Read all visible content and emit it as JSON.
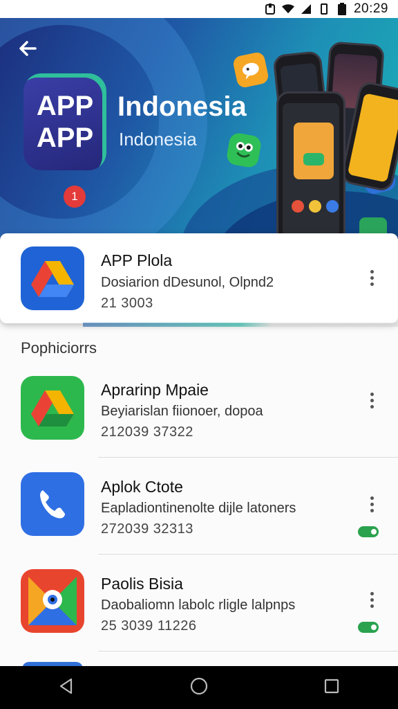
{
  "status_bar": {
    "time": "20:29",
    "icons": [
      "nfc-icon",
      "wifi-icon",
      "signal-icon",
      "vibrate-icon",
      "battery-icon"
    ]
  },
  "hero": {
    "back_icon": "arrow-back-icon",
    "logo_line1": "APP",
    "logo_line2": "APP",
    "title": "Indonesia",
    "subtitle": "Indonesia",
    "badge_count": "1"
  },
  "featured": {
    "icon": "drive-triangle-icon",
    "title": "APP Plola",
    "description": "Dosiarion dDesunol, Olpnd2",
    "meta": "21 3003",
    "more_icon": "more-vert-icon"
  },
  "section": {
    "header": "Pophiciorrs"
  },
  "apps": [
    {
      "icon": "drive-triangle-icon",
      "title": "Aprarinp Mpaie",
      "description": "Beyiarislan fiionoer, dopoa",
      "meta": "212039 37322",
      "more_icon": "more-vert-icon",
      "toggle": false
    },
    {
      "icon": "phone-icon",
      "title": "Aplok Ctote",
      "description": "Eapladiontinenolte dijle latoners",
      "meta": "272039 32313",
      "more_icon": "more-vert-icon",
      "toggle": true
    },
    {
      "icon": "maps-pin-icon",
      "title": "Paolis Bisia",
      "description": "Daobaliomn labolc rligle lalpnps",
      "meta": "25 3039 11226",
      "more_icon": "more-vert-icon",
      "toggle": true
    }
  ],
  "nav": {
    "back": "nav-back-icon",
    "home": "nav-home-icon",
    "recents": "nav-recents-icon"
  },
  "colors": {
    "hero_start": "#1c2f7e",
    "hero_end": "#1bb3b7",
    "toggle_on": "#2aa24e",
    "badge": "#e33a3a"
  }
}
